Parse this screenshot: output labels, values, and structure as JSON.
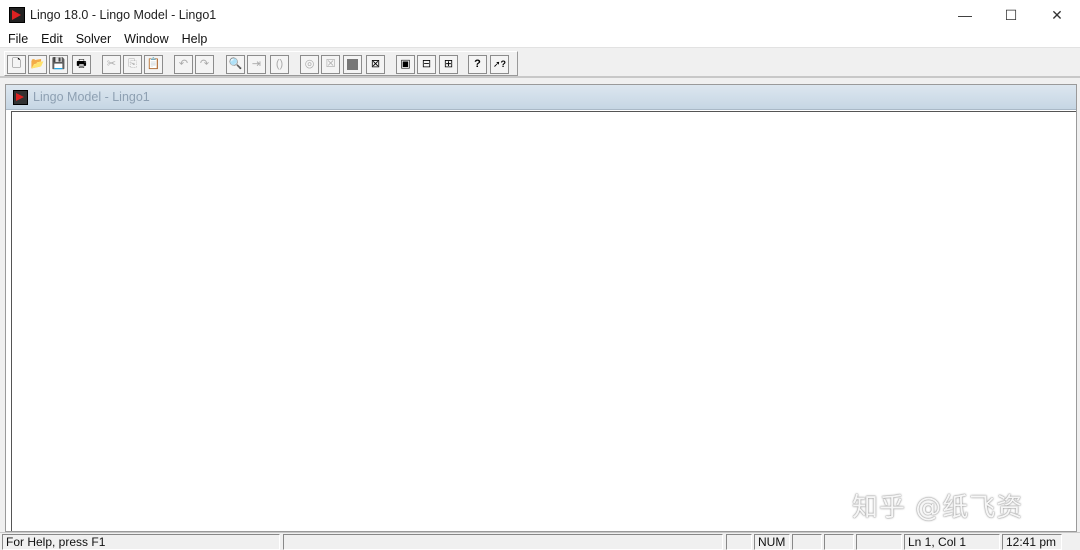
{
  "window": {
    "title": "Lingo 18.0 - Lingo Model - Lingo1",
    "minimize": "—",
    "maximize": "☐",
    "close": "✕"
  },
  "menu": [
    "File",
    "Edit",
    "Solver",
    "Window",
    "Help"
  ],
  "toolbar": {
    "buttons": [
      {
        "name": "new-file-icon",
        "glyph": "🗋"
      },
      {
        "name": "open-file-icon",
        "glyph": "📂"
      },
      {
        "name": "save-icon",
        "glyph": "💾"
      },
      {
        "name": "print-icon",
        "glyph": "🖶"
      },
      {
        "name": "cut-icon",
        "glyph": "✂"
      },
      {
        "name": "copy-icon",
        "glyph": "⎘"
      },
      {
        "name": "paste-icon",
        "glyph": "📋"
      },
      {
        "name": "undo-icon",
        "glyph": "↶"
      },
      {
        "name": "redo-icon",
        "glyph": "↷"
      },
      {
        "name": "find-icon",
        "glyph": "🔍"
      },
      {
        "name": "goto-line-icon",
        "glyph": "⇥"
      },
      {
        "name": "match-parenthesis-icon",
        "glyph": "()"
      },
      {
        "name": "solve-icon",
        "glyph": "◎"
      },
      {
        "name": "solution-icon",
        "glyph": "☒"
      },
      {
        "name": "block-icon",
        "glyph": ""
      },
      {
        "name": "close-all-icon",
        "glyph": "⊠"
      },
      {
        "name": "send-to-back-icon",
        "glyph": "▣"
      },
      {
        "name": "options-icon",
        "glyph": "⊟"
      },
      {
        "name": "tile-icon",
        "glyph": "⊞"
      },
      {
        "name": "help-topics-icon",
        "glyph": "?"
      },
      {
        "name": "context-help-icon",
        "glyph": "➚?"
      }
    ]
  },
  "child_window": {
    "title": "Lingo Model - Lingo1"
  },
  "status": {
    "help": "For Help, press F1",
    "num": "NUM",
    "position": "Ln 1, Col 1",
    "time": "12:41 pm"
  },
  "watermark": "知乎 @纸飞资"
}
